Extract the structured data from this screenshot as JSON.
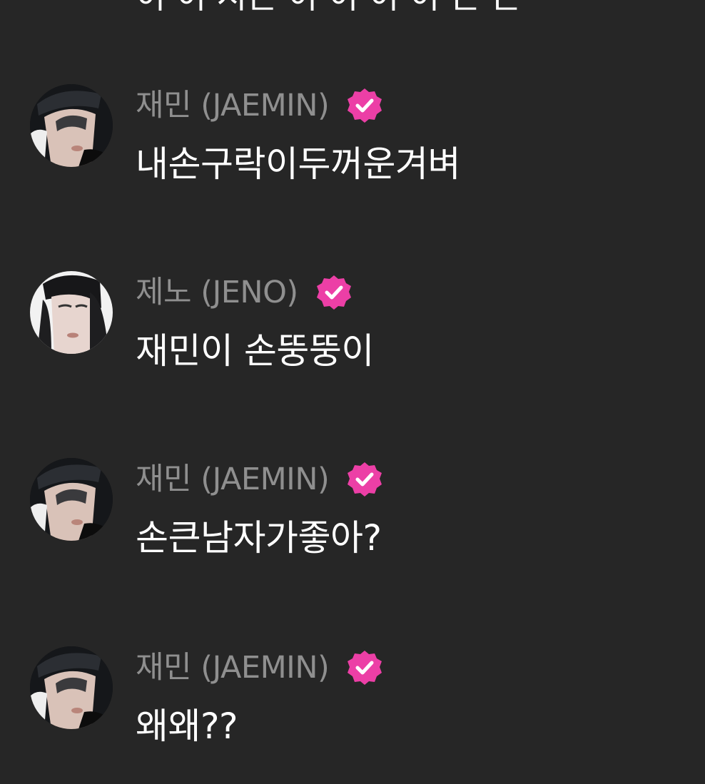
{
  "top_cut_text": "이 이 시근 이 이 이 이 근 근",
  "colors": {
    "background": "#262626",
    "name": "#8f8f8f",
    "message": "#ffffff",
    "badge": "#ec3fa6"
  },
  "messages": [
    {
      "author": "재민 (JAEMIN)",
      "avatar": "jaemin-avatar",
      "verified_icon": "verified-badge-icon",
      "text": "내손구락이두꺼운겨벼"
    },
    {
      "author": "제노 (JENO)",
      "avatar": "jeno-avatar",
      "verified_icon": "verified-badge-icon",
      "text": "재민이 손뚱뚱이"
    },
    {
      "author": "재민 (JAEMIN)",
      "avatar": "jaemin-avatar",
      "verified_icon": "verified-badge-icon",
      "text": "손큰남자가좋아?"
    },
    {
      "author": "재민 (JAEMIN)",
      "avatar": "jaemin-avatar",
      "verified_icon": "verified-badge-icon",
      "text": "왜왜??"
    }
  ]
}
